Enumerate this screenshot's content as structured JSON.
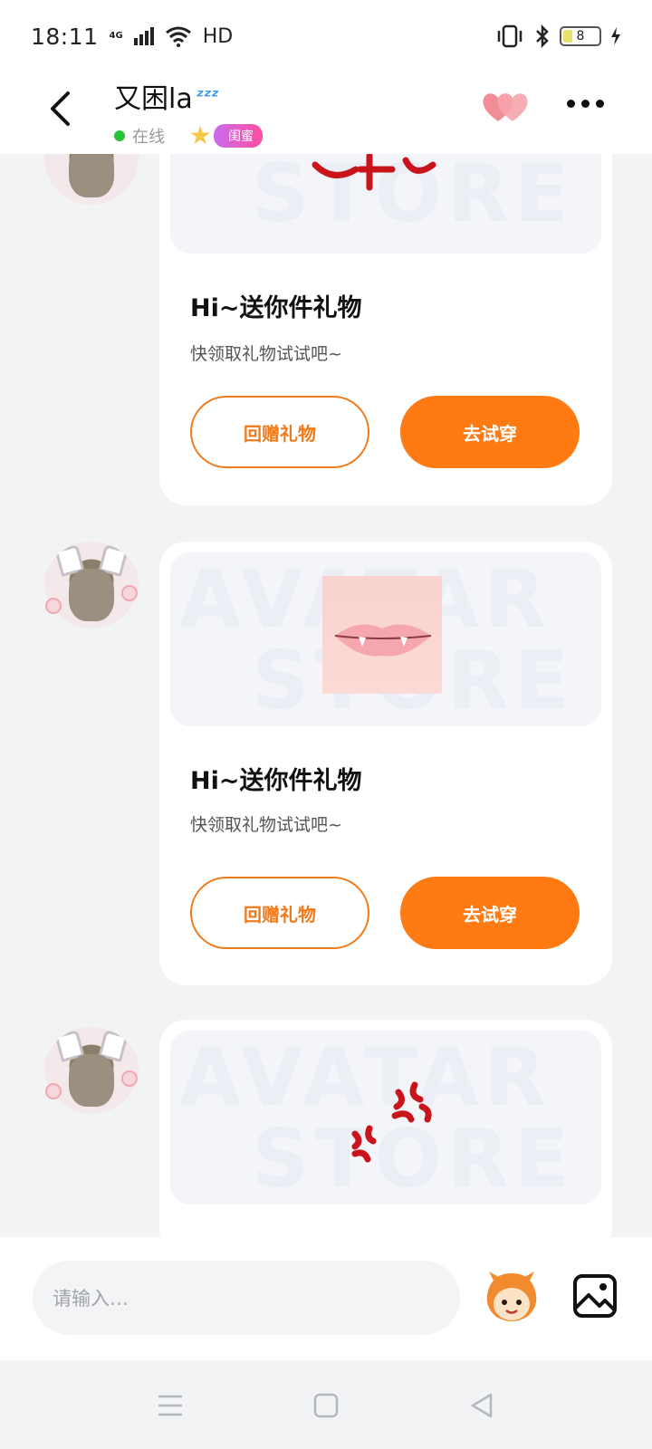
{
  "status_bar": {
    "time": "18:11",
    "network": "4G",
    "hd": "HD",
    "battery": "8"
  },
  "header": {
    "nickname": "又困la",
    "zzz": "ᶻᶻᶻ",
    "status_text": "在线",
    "badge_text": "闺蜜"
  },
  "messages": [
    {
      "title": "Hi~送你件礼物",
      "subtitle": "快领取礼物试试吧~",
      "left_button": "回赠礼物",
      "right_button": "去试穿"
    },
    {
      "title": "Hi~送你件礼物",
      "subtitle": "快领取礼物试试吧~",
      "left_button": "回赠礼物",
      "right_button": "去试穿"
    }
  ],
  "input": {
    "placeholder": "请输入…"
  },
  "icons": {
    "back": "back-arrow-icon",
    "hearts": "hearts-icon",
    "more": "more-icon",
    "emoji": "emoji-mascot-icon",
    "image": "image-icon",
    "nav_menu": "menu-icon",
    "nav_home": "home-square-icon",
    "nav_back": "back-triangle-icon"
  },
  "colors": {
    "accent": "#ff7a12",
    "online": "#27c23a",
    "badge_start": "#c96cf0",
    "badge_end": "#ff4f9e"
  }
}
